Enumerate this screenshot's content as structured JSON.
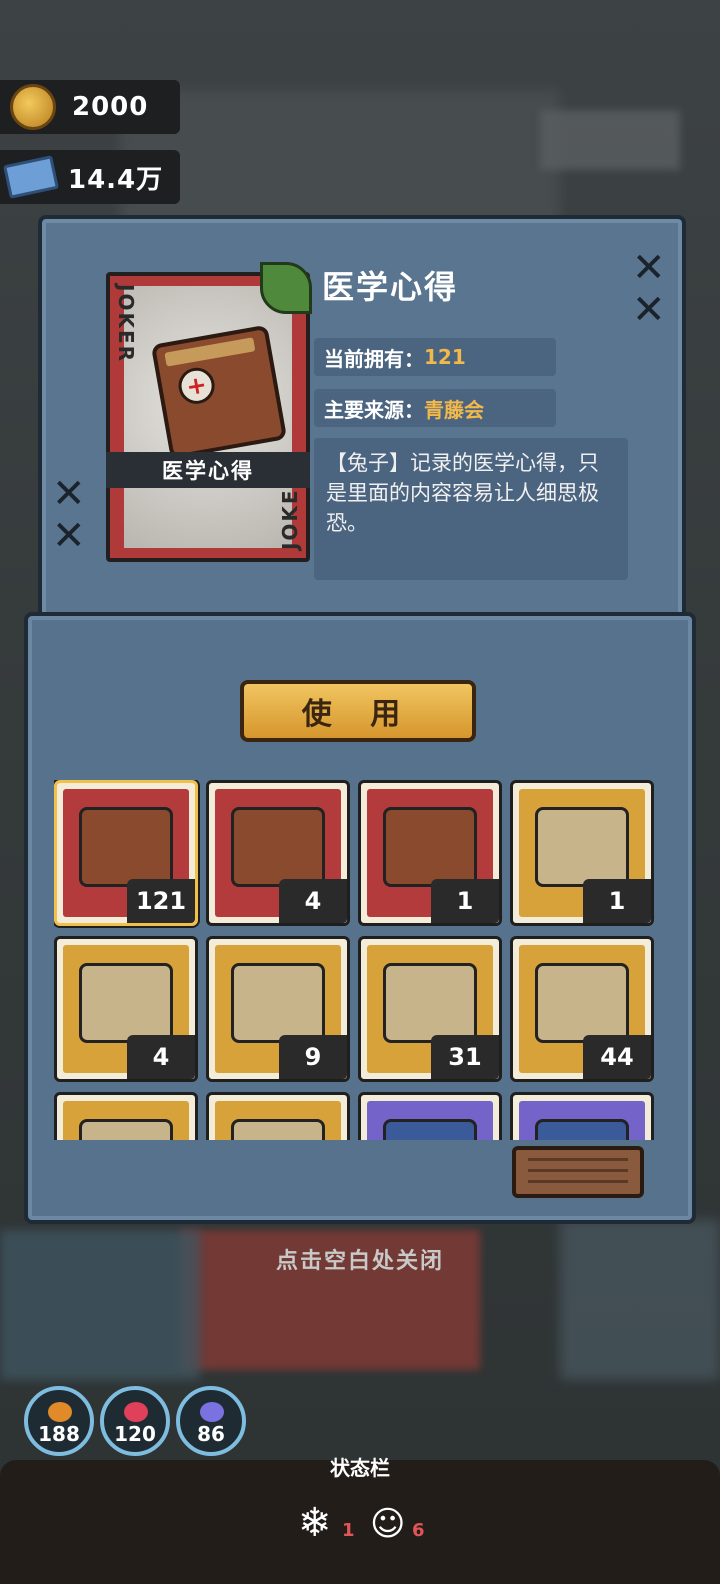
{
  "currency": {
    "coins": "2000",
    "cash": "14.4万"
  },
  "item": {
    "card_name": "医学心得",
    "title": "医学心得",
    "joker_text": "JOKER",
    "owned_label": "当前拥有：",
    "owned_value": "121",
    "source_label": "主要来源：",
    "source_value": "青藤会",
    "description": "【兔子】记录的医学心得，只是里面的内容容易让人细思极恐。"
  },
  "use_button": "使 用",
  "inventory": [
    {
      "name": "medical-notebook",
      "count": "121",
      "color": "red",
      "selected": true
    },
    {
      "name": "id-card",
      "count": "4",
      "color": "red"
    },
    {
      "name": "gold-badge",
      "count": "1",
      "color": "red"
    },
    {
      "name": "capybara-pack",
      "count": "1",
      "color": "yellow"
    },
    {
      "name": "treasure-map",
      "count": "4",
      "color": "yellow"
    },
    {
      "name": "film-reel",
      "count": "9",
      "color": "yellow"
    },
    {
      "name": "starred-gold-badge",
      "count": "31",
      "color": "yellow"
    },
    {
      "name": "medical-card",
      "count": "44",
      "color": "yellow"
    },
    {
      "name": "item-9",
      "count": "",
      "color": "yellow"
    },
    {
      "name": "item-10",
      "count": "",
      "color": "yellow"
    },
    {
      "name": "item-11",
      "count": "",
      "color": "purple"
    },
    {
      "name": "item-12",
      "count": "",
      "color": "purple"
    }
  ],
  "close_hint": "点击空白处关闭",
  "stats": [
    {
      "name": "hunger",
      "value": "188",
      "color": "#e08a2a"
    },
    {
      "name": "health",
      "value": "120",
      "color": "#e0405a"
    },
    {
      "name": "sanity",
      "value": "86",
      "color": "#7a72e0"
    }
  ],
  "statusbar": {
    "label": "状态栏",
    "effects": [
      {
        "icon": "snowflake-icon",
        "count": "1"
      },
      {
        "icon": "masks-icon",
        "count": "6"
      }
    ]
  }
}
